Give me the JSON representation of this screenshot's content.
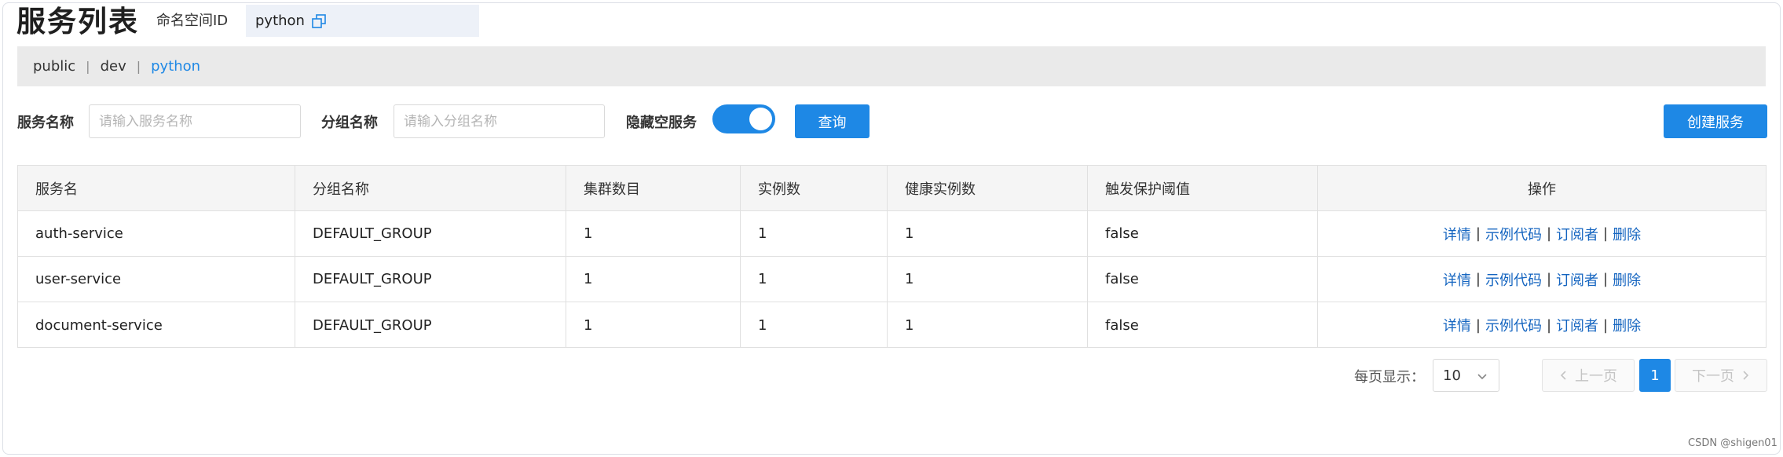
{
  "header": {
    "title": "服务列表",
    "namespace_label": "命名空间ID",
    "namespace_value": "python"
  },
  "namespaces": [
    {
      "label": "public",
      "active": false
    },
    {
      "label": "dev",
      "active": false
    },
    {
      "label": "python",
      "active": true
    }
  ],
  "namespace_separator": "|",
  "filters": {
    "service_name_label": "服务名称",
    "service_name_placeholder": "请输入服务名称",
    "group_name_label": "分组名称",
    "group_name_placeholder": "请输入分组名称",
    "hide_empty_label": "隐藏空服务",
    "hide_empty_enabled": true,
    "query_button": "查询",
    "create_button": "创建服务"
  },
  "table": {
    "columns": [
      "服务名",
      "分组名称",
      "集群数目",
      "实例数",
      "健康实例数",
      "触发保护阈值",
      "操作"
    ],
    "rows": [
      [
        "auth-service",
        "DEFAULT_GROUP",
        "1",
        "1",
        "1",
        "false"
      ],
      [
        "user-service",
        "DEFAULT_GROUP",
        "1",
        "1",
        "1",
        "false"
      ],
      [
        "document-service",
        "DEFAULT_GROUP",
        "1",
        "1",
        "1",
        "false"
      ]
    ],
    "actions": [
      "详情",
      "示例代码",
      "订阅者",
      "删除"
    ],
    "action_separator": "|"
  },
  "pagination": {
    "page_size_label": "每页显示：",
    "page_size": "10",
    "prev_label": "上一页",
    "next_label": "下一页",
    "current_page": "1"
  },
  "watermark": "CSDN @shigen01",
  "colors": {
    "accent": "#1e88e5",
    "link": "#1565c0"
  },
  "icons": {
    "copy": "copy-icon",
    "select_chevron": "chevron-down-icon",
    "prev": "chevron-left-icon",
    "next": "chevron-right-icon"
  }
}
